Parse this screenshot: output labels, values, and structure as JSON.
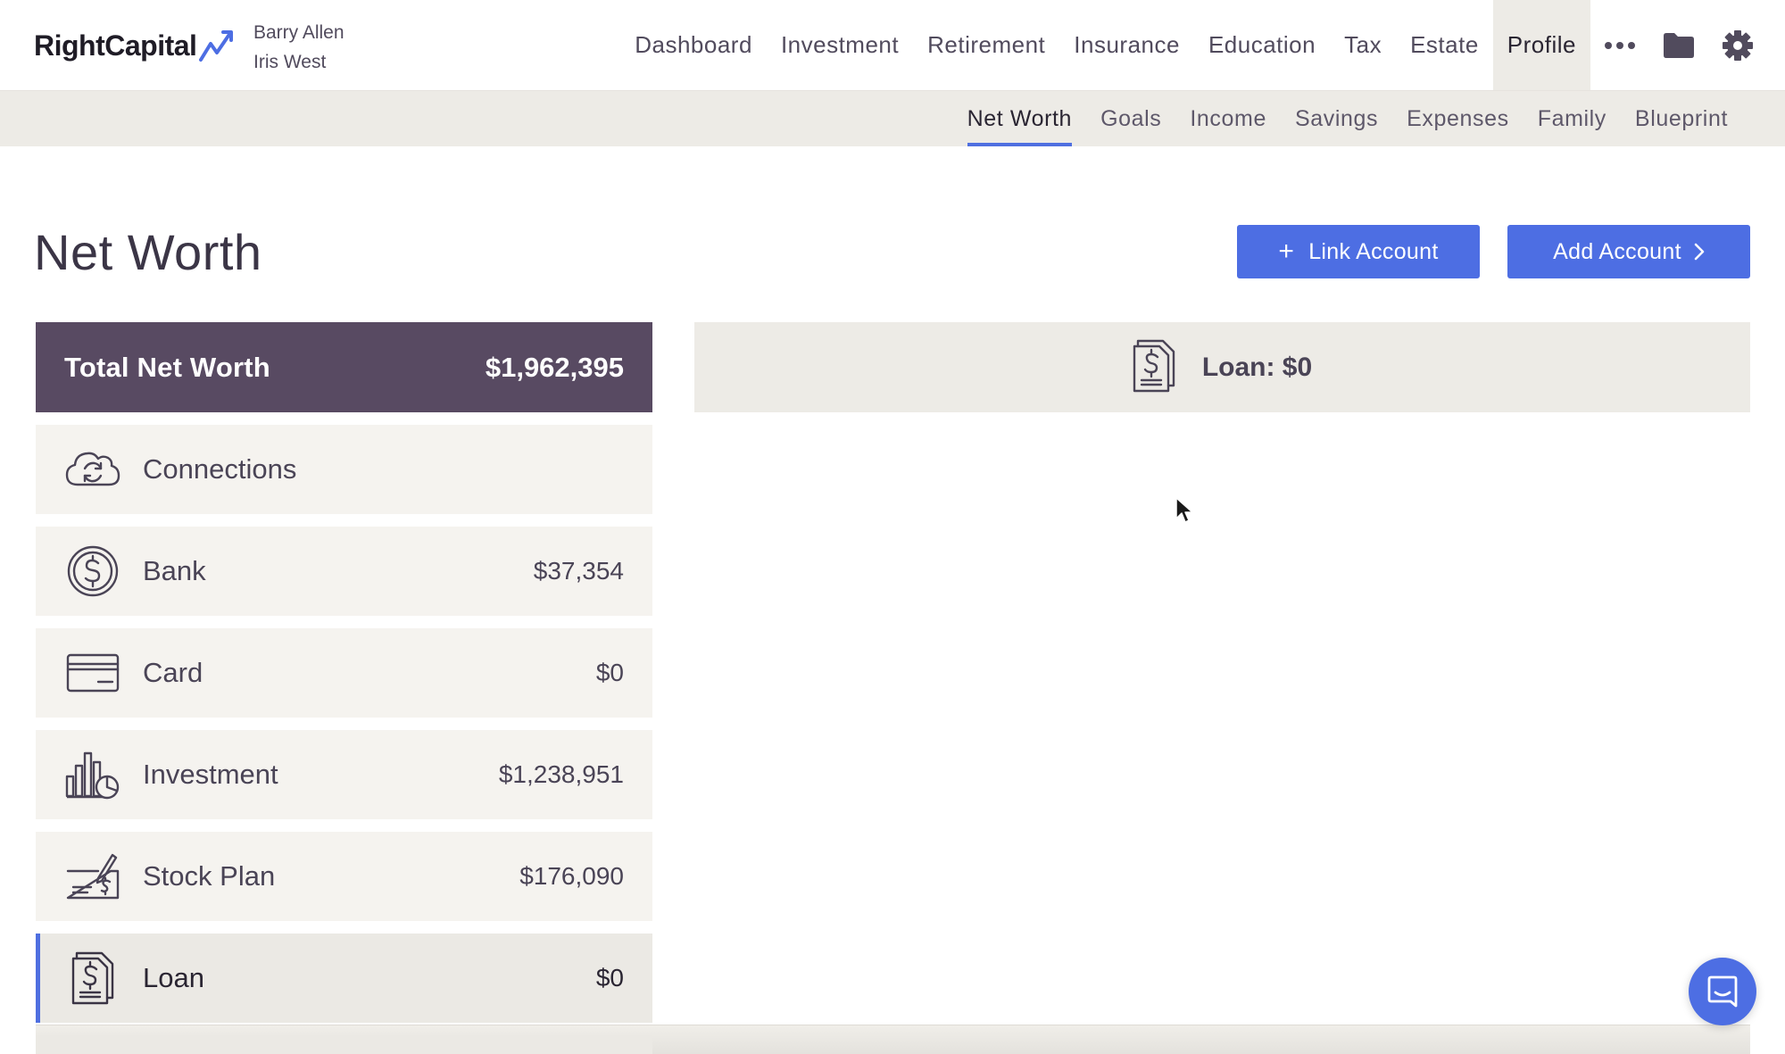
{
  "brand": {
    "name": "RightCapital",
    "accent": "#4d6ee3"
  },
  "clients": [
    "Barry Allen",
    "Iris West"
  ],
  "top_nav": {
    "items": [
      {
        "label": "Dashboard",
        "active": false
      },
      {
        "label": "Investment",
        "active": false
      },
      {
        "label": "Retirement",
        "active": false
      },
      {
        "label": "Insurance",
        "active": false
      },
      {
        "label": "Education",
        "active": false
      },
      {
        "label": "Tax",
        "active": false
      },
      {
        "label": "Estate",
        "active": false
      },
      {
        "label": "Profile",
        "active": true
      }
    ],
    "icons": [
      "more-icon",
      "folder-icon",
      "gear-icon"
    ]
  },
  "sub_nav": {
    "items": [
      {
        "label": "Net Worth",
        "active": true
      },
      {
        "label": "Goals",
        "active": false
      },
      {
        "label": "Income",
        "active": false
      },
      {
        "label": "Savings",
        "active": false
      },
      {
        "label": "Expenses",
        "active": false
      },
      {
        "label": "Family",
        "active": false
      },
      {
        "label": "Blueprint",
        "active": false
      }
    ]
  },
  "page": {
    "title": "Net Worth",
    "link_account_label": "Link Account",
    "add_account_label": "Add Account"
  },
  "net_worth": {
    "total_label": "Total Net Worth",
    "total_value": "$1,962,395",
    "accounts": [
      {
        "name": "Connections",
        "value": "",
        "icon": "cloud-sync-icon",
        "active": false
      },
      {
        "name": "Bank",
        "value": "$37,354",
        "icon": "dollar-coin-icon",
        "active": false
      },
      {
        "name": "Card",
        "value": "$0",
        "icon": "credit-card-icon",
        "active": false
      },
      {
        "name": "Investment",
        "value": "$1,238,951",
        "icon": "investment-chart-icon",
        "active": false
      },
      {
        "name": "Stock Plan",
        "value": "$176,090",
        "icon": "stock-plan-icon",
        "active": false
      },
      {
        "name": "Loan",
        "value": "$0",
        "icon": "loan-document-icon",
        "active": true
      }
    ]
  },
  "detail": {
    "title": "Loan: $0",
    "icon": "loan-document-icon"
  },
  "chat": {
    "icon": "chat-icon"
  }
}
